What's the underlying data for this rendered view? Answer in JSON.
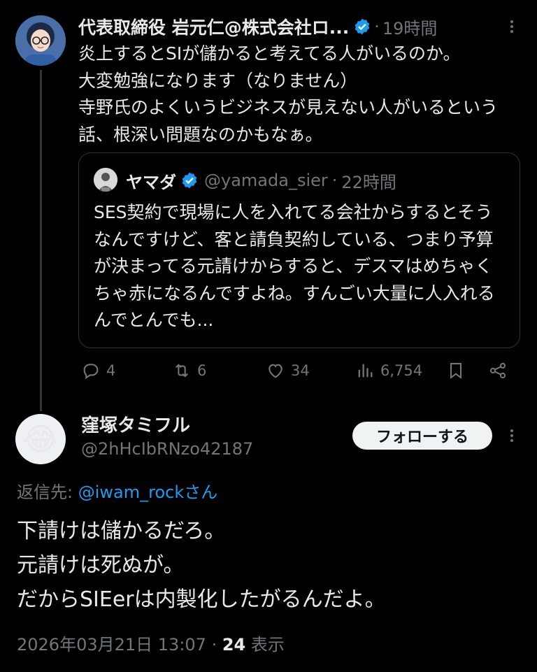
{
  "parent_tweet": {
    "author_name": "代表取締役 岩元仁@株式会社ロ...",
    "time_sep": "·",
    "time": "19時間",
    "body": "炎上するとSIが儲かると考えてる人がいるのか。\n大変勉強になります（なりません）\n寺野氏のよくいうビジネスが見えない人がいるという話、根深い問題なのかもなぁ。",
    "quote": {
      "author_name": "ヤマダ",
      "handle": "@yamada_sier",
      "time": "22時間",
      "time_sep": "·",
      "body": "SES契約で現場に人を入れてる会社からするとそうなんですけど、客と請負契約している、つまり予算が決まってる元請けからすると、デスマはめちゃくちゃ赤になるんですよね。すんごい大量に人入れるんでとんでも..."
    },
    "actions": {
      "replies": "4",
      "reposts": "6",
      "likes": "34",
      "views": "6,754"
    }
  },
  "reply_tweet": {
    "avatar_emoji": "😂",
    "author_name": "窪塚タミフル",
    "handle": "@2hHcIbRNzo42187",
    "follow_label": "フォローする",
    "reply_prefix": "返信先: ",
    "reply_target": "@iwam_rock",
    "reply_suffix": "さん",
    "body": "下請けは儲かるだろ。\n元請けは死ぬが。\nだからSIEerは内製化したがるんだよ。",
    "timestamp": "2026年03月21日 13:07",
    "footer_sep": " · ",
    "view_count": "24",
    "view_label": " 表示"
  },
  "colors": {
    "background": "#000000",
    "text": "#e7e9ea",
    "muted": "#71767b",
    "link": "#1d9bf0",
    "verified": "#1d9bf0"
  }
}
